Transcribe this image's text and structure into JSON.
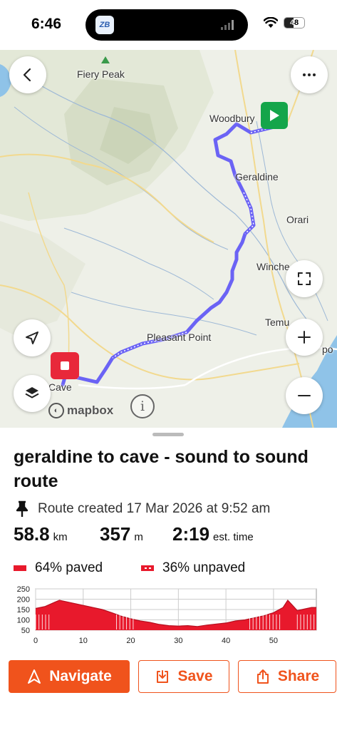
{
  "status_bar": {
    "time": "6:46",
    "island_app_label": "ZB",
    "battery": "48"
  },
  "map": {
    "labels": {
      "fiery_peak": "Fiery Peak",
      "woodbury": "Woodbury",
      "geraldine": "Geraldine",
      "orari": "Orari",
      "winchester": "Winche",
      "temuka": "Temu",
      "pleasant_point": "Pleasant Point",
      "cave": "Cave",
      "opihi": "po"
    },
    "attribution": "mapbox",
    "info_glyph": "i",
    "colors": {
      "route": "#6b63f5",
      "start_marker": "#14a54a",
      "end_marker": "#e8283a",
      "water": "#8fc3e8"
    }
  },
  "route": {
    "title": "geraldine to cave - sound to sound route",
    "created": "Route created 17 Mar 2026 at 9:52 am",
    "distance_value": "58.8",
    "distance_unit": "km",
    "elevation_value": "357",
    "elevation_unit": "m",
    "time_value": "2:19",
    "time_unit": "est. time",
    "paved": "64% paved",
    "unpaved": "36% unpaved"
  },
  "chart_data": {
    "type": "area",
    "xlabel": "",
    "ylabel": "",
    "x_ticks": [
      "0",
      "10",
      "20",
      "30",
      "40",
      "50"
    ],
    "y_ticks": [
      "250",
      "200",
      "150",
      "100",
      "50"
    ],
    "xlim": [
      0,
      59
    ],
    "ylim": [
      50,
      250
    ],
    "grid": true,
    "series": [
      {
        "x": [
          0,
          2,
          4,
          5,
          6,
          8,
          10,
          12,
          14,
          16,
          18,
          20,
          22,
          24,
          26,
          28,
          30,
          32,
          34,
          36,
          38,
          40,
          42,
          44,
          46,
          48,
          50,
          52,
          53,
          54,
          55,
          56,
          58,
          59
        ],
        "y": [
          155,
          165,
          185,
          195,
          190,
          180,
          170,
          160,
          150,
          135,
          118,
          105,
          95,
          88,
          78,
          72,
          70,
          72,
          68,
          75,
          80,
          85,
          95,
          100,
          110,
          120,
          135,
          160,
          195,
          170,
          145,
          150,
          160,
          160
        ]
      }
    ]
  },
  "actions": {
    "navigate": "Navigate",
    "save": "Save",
    "share": "Share"
  }
}
